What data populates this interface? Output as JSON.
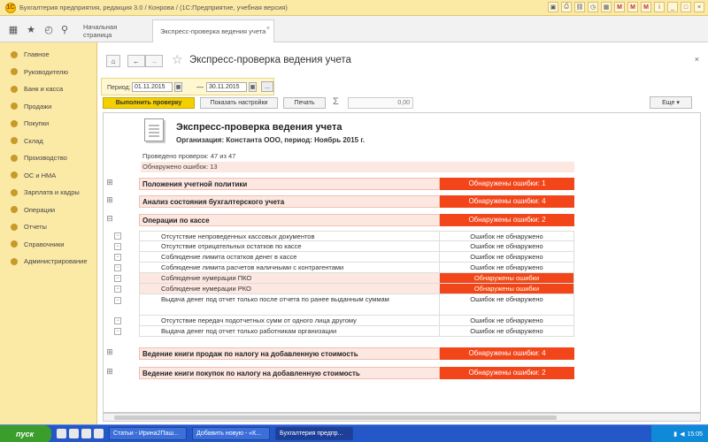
{
  "window": {
    "title": "Бухгалтерия предприятия, редакция 3.0 / Конрова / (1С:Предприятие, учебная версия)"
  },
  "tabs": {
    "home": "Начальная страница",
    "active": "Экспресс-проверка ведения учета"
  },
  "sidebar": {
    "items": [
      {
        "label": "Главное"
      },
      {
        "label": "Руководителю"
      },
      {
        "label": "Банк и касса"
      },
      {
        "label": "Продажи"
      },
      {
        "label": "Покупки"
      },
      {
        "label": "Склад"
      },
      {
        "label": "Производство"
      },
      {
        "label": "ОС и НМА"
      },
      {
        "label": "Зарплата и кадры"
      },
      {
        "label": "Операции"
      },
      {
        "label": "Отчеты"
      },
      {
        "label": "Справочники"
      },
      {
        "label": "Администрирование"
      }
    ]
  },
  "form": {
    "title": "Экспресс-проверка ведения учета",
    "period_label": "Период:",
    "date_from": "01.11.2015",
    "date_to": "30.11.2015",
    "run_button": "Выполнить проверку",
    "settings_button": "Показать настройки",
    "print_button": "Печать",
    "sum_value": "0,00",
    "more_button": "Еще"
  },
  "report": {
    "title": "Экспресс-проверка ведения учета",
    "org": "Организация: Константа ООО, период: Ноябрь 2015 г.",
    "checks_done": "Проведено проверок: 47 из 47",
    "errors_found": "Обнаружено ошибок: 13",
    "sections": [
      {
        "name": "Положения учетной политики",
        "status": "Обнаружены ошибки: 1"
      },
      {
        "name": "Анализ состояния бухгалтерского учета",
        "status": "Обнаружены ошибки: 4"
      },
      {
        "name": "Операции по кассе",
        "status": "Обнаружены ошибки: 2"
      },
      {
        "name": "Ведение книги продаж по налогу на добавленную стоимость",
        "status": "Обнаружены ошибки: 4"
      },
      {
        "name": "Ведение книги покупок по налогу на добавленную стоимость",
        "status": "Обнаружены ошибки: 2"
      }
    ],
    "cash_checks": [
      {
        "name": "Отсутствие непроведенных кассовых документов",
        "status": "Ошибок не обнаружено"
      },
      {
        "name": "Отсутствие отрицательных остатков по кассе",
        "status": "Ошибок не обнаружено"
      },
      {
        "name": "Соблюдение лимита остатков денег в кассе",
        "status": "Ошибок не обнаружено"
      },
      {
        "name": "Соблюдение лимита расчетов наличными с контрагентами",
        "status": "Ошибок не обнаружено"
      },
      {
        "name": "Соблюдение нумерации ПКО",
        "status": "Обнаружены ошибки"
      },
      {
        "name": "Соблюдение нумерации РКО",
        "status": "Обнаружены ошибки"
      },
      {
        "name": "Выдача денег под отчет только после отчета по ранее выданным суммам",
        "status": "Ошибок не обнаружено"
      },
      {
        "name": "Отсутствие передач подотчетных сумм от одного лица другому",
        "status": "Ошибок не обнаружено"
      },
      {
        "name": "Выдача денег под отчет только работникам организации",
        "status": "Ошибок не обнаружено"
      }
    ]
  },
  "taskbar": {
    "start": "пуск",
    "tasks": [
      {
        "label": "Статьи - Ирина2Паш..."
      },
      {
        "label": "Добавить новую - «К..."
      },
      {
        "label": "Бухгалтерия предпр..."
      }
    ],
    "clock": "15:05"
  }
}
